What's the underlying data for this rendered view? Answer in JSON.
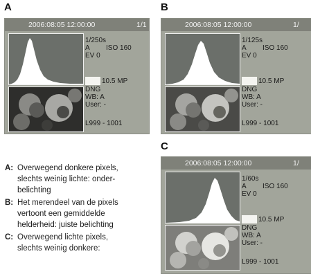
{
  "panels": [
    {
      "letter": "A",
      "datetime": "2006:08:05 12:00:00",
      "page": "1/1",
      "shutter": "1/250s",
      "mode": "A",
      "iso": "ISO 160",
      "ev": "EV 0",
      "mp": "10.5 MP",
      "format": "DNG",
      "wb": "WB: A",
      "user": "User: -",
      "file": "L999 - 1001"
    },
    {
      "letter": "B",
      "datetime": "2006:08:05 12:00:00",
      "page": "1/",
      "shutter": "1/125s",
      "mode": "A",
      "iso": "ISO 160",
      "ev": "EV 0",
      "mp": "10.5 MP",
      "format": "DNG",
      "wb": "WB: A",
      "user": "User: -",
      "file": "L999 - 1001"
    },
    {
      "letter": "C",
      "datetime": "2006:08:05 12:00:00",
      "page": "1/",
      "shutter": "1/60s",
      "mode": "A",
      "iso": "ISO 160",
      "ev": "EV 0",
      "mp": "10.5 MP",
      "format": "DNG",
      "wb": "WB: A",
      "user": "User: -",
      "file": "L999 - 1001"
    }
  ],
  "explanation": [
    {
      "key": "A:",
      "lines": [
        "Overwegend donkere pixels,",
        "slechts weinig lichte: onder-",
        "belichting"
      ]
    },
    {
      "key": "B:",
      "lines": [
        "Het merendeel van de pixels",
        "vertoont een gemiddelde",
        "helderheid: juiste belichting"
      ]
    },
    {
      "key": "C:",
      "lines": [
        "Overwegend lichte pixels,",
        "slechts weinig donkere:"
      ]
    }
  ],
  "colors": {
    "screen_bg": "#a2a59b",
    "header_bg": "#7f8179",
    "histogram_fill": "#ffffff",
    "histogram_bg": "#6b6f6a"
  },
  "icons": {
    "histogram": "histogram-graph",
    "thumbnail": "photo-thumbnail"
  }
}
